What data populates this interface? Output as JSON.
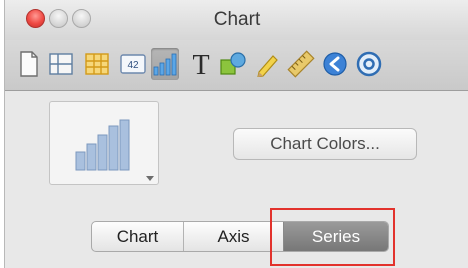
{
  "window": {
    "title": "Chart"
  },
  "toolbar": {
    "tools": [
      {
        "name": "document-icon"
      },
      {
        "name": "layout-icon"
      },
      {
        "name": "table-icon"
      },
      {
        "name": "text-box-icon",
        "label": "42"
      },
      {
        "name": "chart-icon",
        "selected": true
      },
      {
        "name": "text-icon",
        "label": "T"
      },
      {
        "name": "shapes-icon"
      },
      {
        "name": "pencil-icon"
      },
      {
        "name": "ruler-icon"
      },
      {
        "name": "navigate-icon"
      },
      {
        "name": "at-icon"
      }
    ]
  },
  "panel": {
    "chart_colors_label": "Chart Colors...",
    "tabs": [
      {
        "label": "Chart",
        "selected": false
      },
      {
        "label": "Axis",
        "selected": false
      },
      {
        "label": "Series",
        "selected": true
      }
    ]
  },
  "colors": {
    "accent_highlight": "#e2322c",
    "selected_tab": "#888888"
  }
}
